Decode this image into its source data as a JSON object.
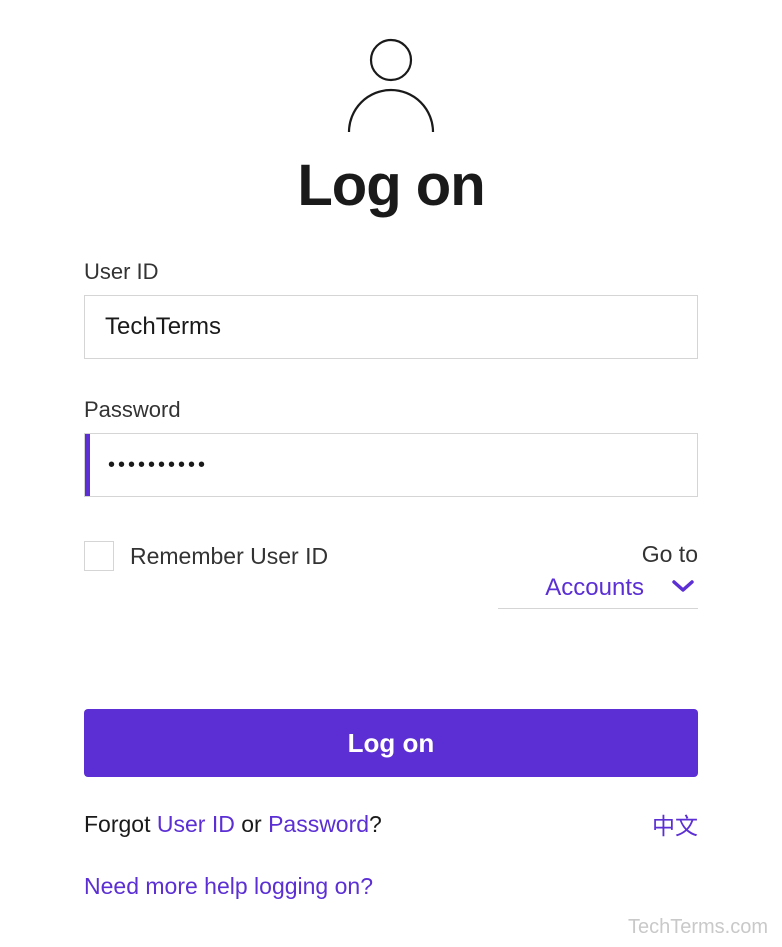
{
  "title": "Log on",
  "fields": {
    "userid": {
      "label": "User ID",
      "value": "TechTerms"
    },
    "password": {
      "label": "Password",
      "value": "••••••••••"
    }
  },
  "remember": {
    "label": "Remember User ID",
    "checked": false
  },
  "goto": {
    "label": "Go to",
    "selected": "Accounts"
  },
  "login_button": "Log on",
  "forgot": {
    "prefix": "Forgot ",
    "userid_link": "User ID",
    "middle": " or ",
    "password_link": "Password",
    "suffix": "?"
  },
  "language_link": "中文",
  "help_link": "Need more help logging on?",
  "watermark": "TechTerms.com",
  "colors": {
    "accent": "#5b2fd4",
    "text": "#1a1a1a",
    "border": "#d5d5d5"
  }
}
